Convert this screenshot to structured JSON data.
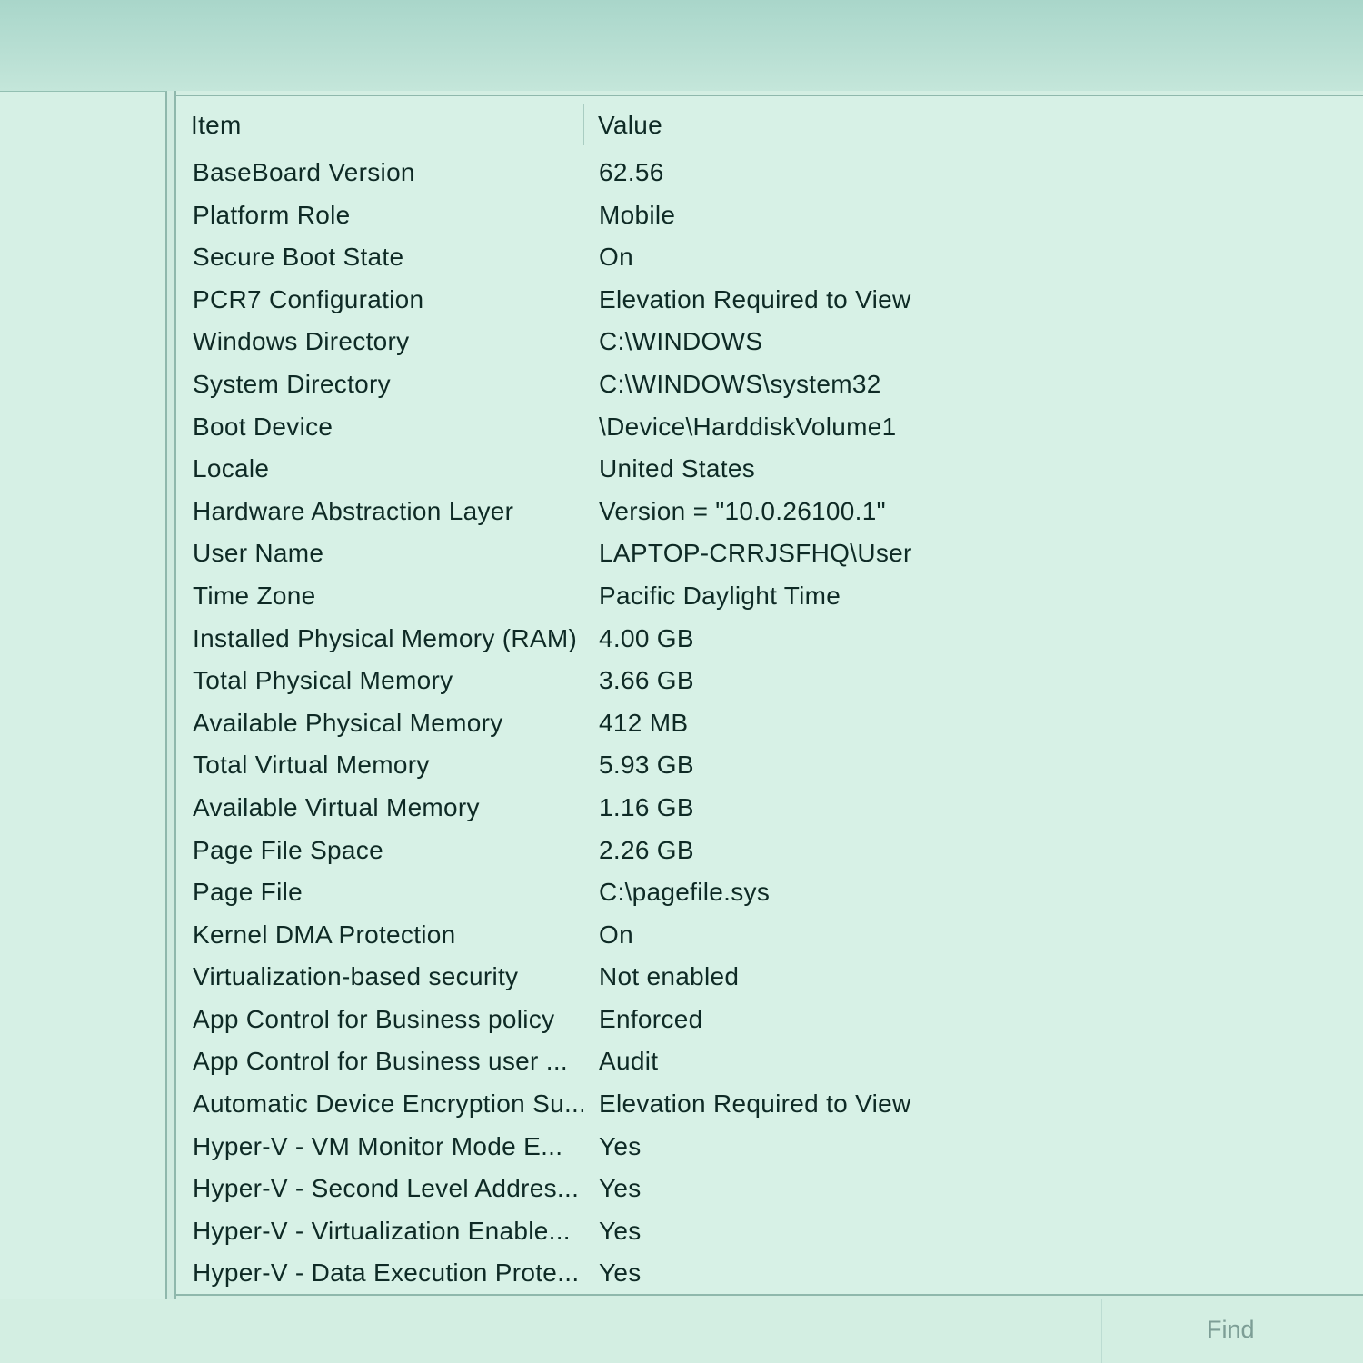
{
  "list": {
    "columns": {
      "item": "Item",
      "value": "Value"
    },
    "rows": [
      {
        "item": "BaseBoard Version",
        "value": "62.56"
      },
      {
        "item": "Platform Role",
        "value": "Mobile"
      },
      {
        "item": "Secure Boot State",
        "value": "On"
      },
      {
        "item": "PCR7 Configuration",
        "value": "Elevation Required to View"
      },
      {
        "item": "Windows Directory",
        "value": "C:\\WINDOWS"
      },
      {
        "item": "System Directory",
        "value": "C:\\WINDOWS\\system32"
      },
      {
        "item": "Boot Device",
        "value": "\\Device\\HarddiskVolume1"
      },
      {
        "item": "Locale",
        "value": "United States"
      },
      {
        "item": "Hardware Abstraction Layer",
        "value": "Version = \"10.0.26100.1\""
      },
      {
        "item": "User Name",
        "value": "LAPTOP-CRRJSFHQ\\User"
      },
      {
        "item": "Time Zone",
        "value": "Pacific Daylight Time"
      },
      {
        "item": "Installed Physical Memory (RAM)",
        "value": "4.00 GB"
      },
      {
        "item": "Total Physical Memory",
        "value": "3.66 GB"
      },
      {
        "item": "Available Physical Memory",
        "value": "412 MB"
      },
      {
        "item": "Total Virtual Memory",
        "value": "5.93 GB"
      },
      {
        "item": "Available Virtual Memory",
        "value": "1.16 GB"
      },
      {
        "item": "Page File Space",
        "value": "2.26 GB"
      },
      {
        "item": "Page File",
        "value": "C:\\pagefile.sys"
      },
      {
        "item": "Kernel DMA Protection",
        "value": "On"
      },
      {
        "item": "Virtualization-based security",
        "value": "Not enabled"
      },
      {
        "item": "App Control for Business policy",
        "value": "Enforced"
      },
      {
        "item": "App Control for Business user ...",
        "value": "Audit"
      },
      {
        "item": "Automatic Device Encryption Su...",
        "value": "Elevation Required to View"
      },
      {
        "item": "Hyper-V - VM Monitor Mode E...",
        "value": "Yes"
      },
      {
        "item": "Hyper-V - Second Level Addres...",
        "value": "Yes"
      },
      {
        "item": "Hyper-V - Virtualization Enable...",
        "value": "Yes"
      },
      {
        "item": "Hyper-V - Data Execution Prote...",
        "value": "Yes"
      }
    ]
  },
  "find": {
    "label": "Find"
  }
}
